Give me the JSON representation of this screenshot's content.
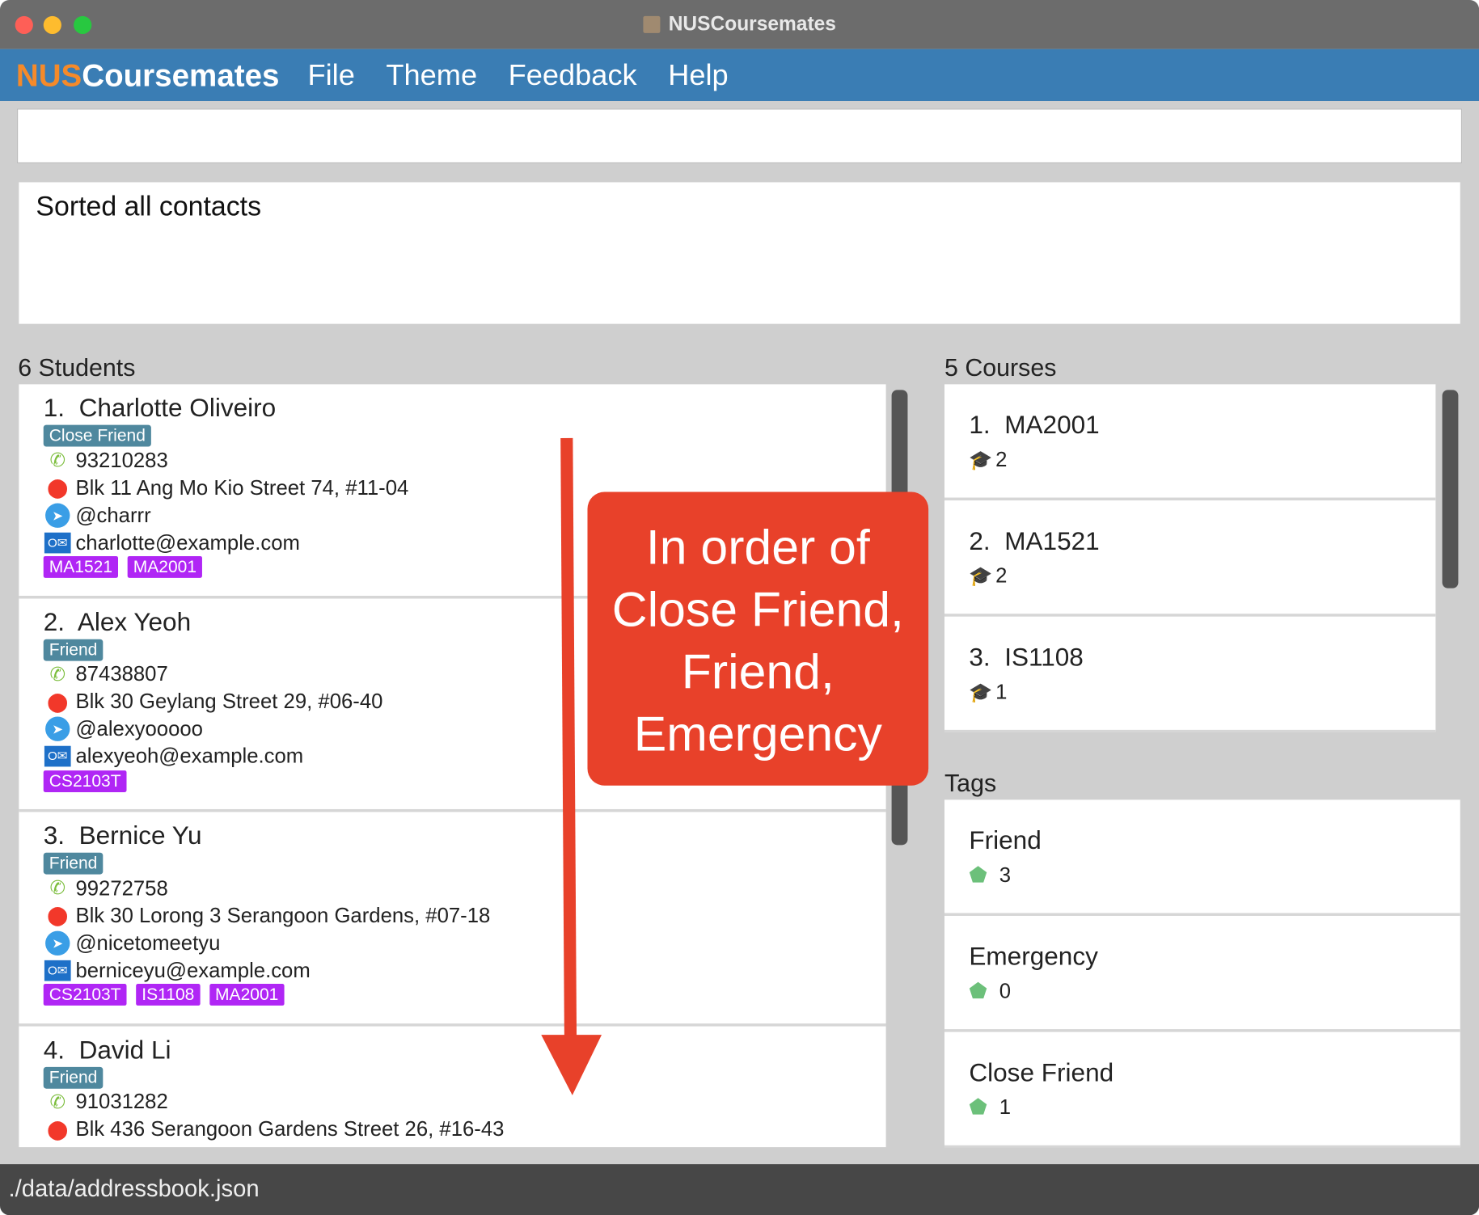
{
  "window": {
    "title": "NUSCoursemates"
  },
  "menubar": {
    "logo_a": "NUS",
    "logo_b": "Coursemates",
    "items": [
      "File",
      "Theme",
      "Feedback",
      "Help"
    ]
  },
  "command": {
    "value": ""
  },
  "result": {
    "text": "Sorted all contacts"
  },
  "students": {
    "header": "6 Students",
    "items": [
      {
        "index": "1.",
        "name": "Charlotte Oliveiro",
        "tag": "Close Friend",
        "phone": "93210283",
        "address": "Blk 11 Ang Mo Kio Street 74, #11-04",
        "telegram": "@charrr",
        "email": "charlotte@example.com",
        "courses": [
          "MA1521",
          "MA2001"
        ]
      },
      {
        "index": "2.",
        "name": "Alex Yeoh",
        "tag": "Friend",
        "phone": "87438807",
        "address": "Blk 30 Geylang Street 29, #06-40",
        "telegram": "@alexyooooo",
        "email": "alexyeoh@example.com",
        "courses": [
          "CS2103T"
        ]
      },
      {
        "index": "3.",
        "name": "Bernice Yu",
        "tag": "Friend",
        "phone": "99272758",
        "address": "Blk 30 Lorong 3 Serangoon Gardens, #07-18",
        "telegram": "@nicetomeetyu",
        "email": "berniceyu@example.com",
        "courses": [
          "CS2103T",
          "IS1108",
          "MA2001"
        ]
      },
      {
        "index": "4.",
        "name": "David Li",
        "tag": "Friend",
        "phone": "91031282",
        "address": "Blk 436 Serangoon Gardens Street 26, #16-43",
        "telegram": "",
        "email": "",
        "courses": []
      }
    ]
  },
  "courses": {
    "header": "5 Courses",
    "items": [
      {
        "index": "1.",
        "code": "MA2001",
        "count": "2"
      },
      {
        "index": "2.",
        "code": "MA1521",
        "count": "2"
      },
      {
        "index": "3.",
        "code": "IS1108",
        "count": "1"
      }
    ]
  },
  "tags": {
    "header": "Tags",
    "items": [
      {
        "name": "Friend",
        "count": "3"
      },
      {
        "name": "Emergency",
        "count": "0"
      },
      {
        "name": "Close Friend",
        "count": "1"
      }
    ]
  },
  "status": {
    "path": "./data/addressbook.json"
  },
  "annotation": {
    "lines": [
      "In order of",
      "Close Friend,",
      "Friend,",
      "Emergency"
    ],
    "color": "#e8412a"
  }
}
